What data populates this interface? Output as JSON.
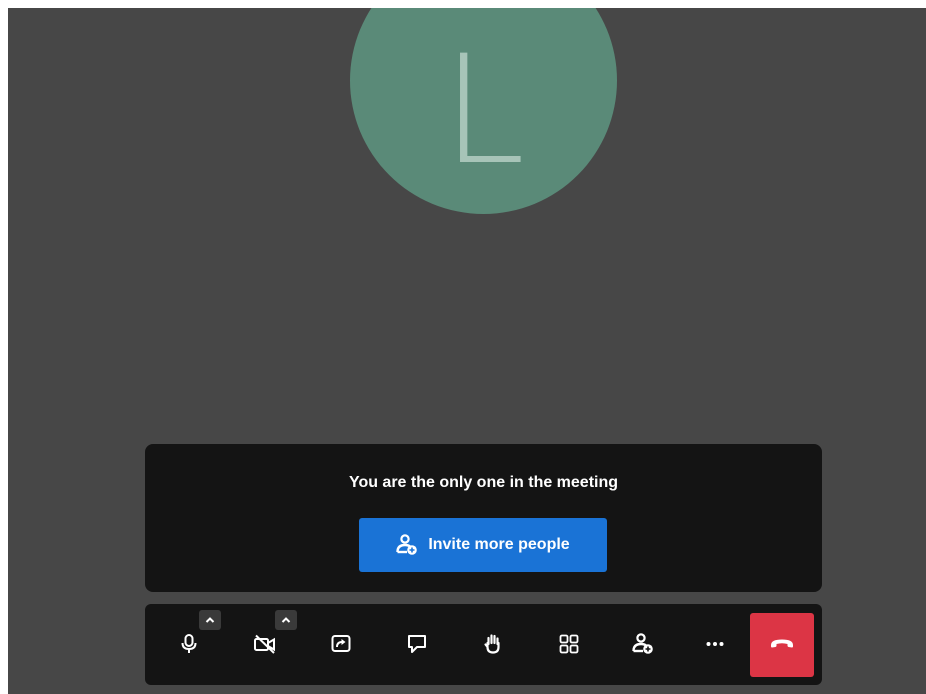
{
  "participant": {
    "initial": "L",
    "avatar_color": "#5a8a78"
  },
  "notice": {
    "message": "You are the only one in the meeting",
    "invite_label": "Invite more people"
  },
  "toolbar": {
    "buttons": [
      {
        "name": "microphone",
        "icon": "microphone-icon"
      },
      {
        "name": "camera-off",
        "icon": "video-off-icon"
      },
      {
        "name": "share-screen",
        "icon": "screen-share-icon"
      },
      {
        "name": "chat",
        "icon": "chat-icon"
      },
      {
        "name": "raise-hand",
        "icon": "hand-icon"
      },
      {
        "name": "tile-view",
        "icon": "grid-icon"
      },
      {
        "name": "participants",
        "icon": "person-add-icon"
      },
      {
        "name": "more",
        "icon": "more-icon"
      },
      {
        "name": "hang-up",
        "icon": "hangup-icon"
      }
    ],
    "more_label": "···"
  },
  "colors": {
    "stage_bg": "#474747",
    "panel_bg": "#141414",
    "invite_blue": "#1a73d6",
    "hangup_red": "#dc3545"
  }
}
